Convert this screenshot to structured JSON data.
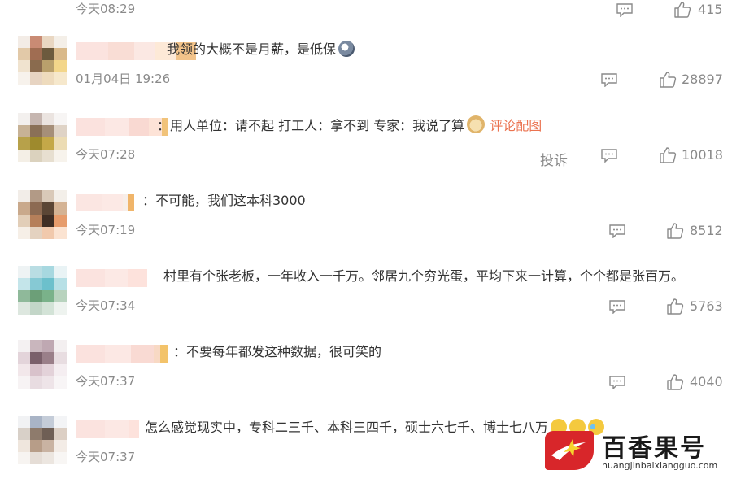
{
  "prev_row": {
    "time": "今天08:29",
    "likes": "415"
  },
  "comments": [
    {
      "text": "我领的大概不是月薪，是低保",
      "time": "01月04日 19:26",
      "likes": "28897",
      "emoji": "grin-face"
    },
    {
      "text": "：用人单位：请不起 打工人：拿不到 专家：我说了算",
      "time": "今天07:28",
      "likes": "10018",
      "emoji": "doge-face",
      "link": "评论配图",
      "report": "投诉"
    },
    {
      "text": "：不可能，我们这本科3000",
      "time": "今天07:19",
      "likes": "8512"
    },
    {
      "text": "村里有个张老板，一年收入一千万。邻居九个穷光蛋，平均下来一计算，个个都是张百万。",
      "time": "今天07:34",
      "likes": "5763"
    },
    {
      "text": "：不要每年都发这种数据，很可笑的",
      "time": "今天07:37",
      "likes": "4040"
    },
    {
      "text": "怎么感觉现实中，专科二三千、本科三四千，硕士六七千、博士七八万",
      "time": "今天07:37",
      "likes": ""
    }
  ],
  "watermark": {
    "brand": "百香果号",
    "url": "huangjinbaixiangguo.com"
  },
  "colors": {
    "link": "#eb7350",
    "muted": "#8a8a8a",
    "brand_red": "#d8262a"
  }
}
